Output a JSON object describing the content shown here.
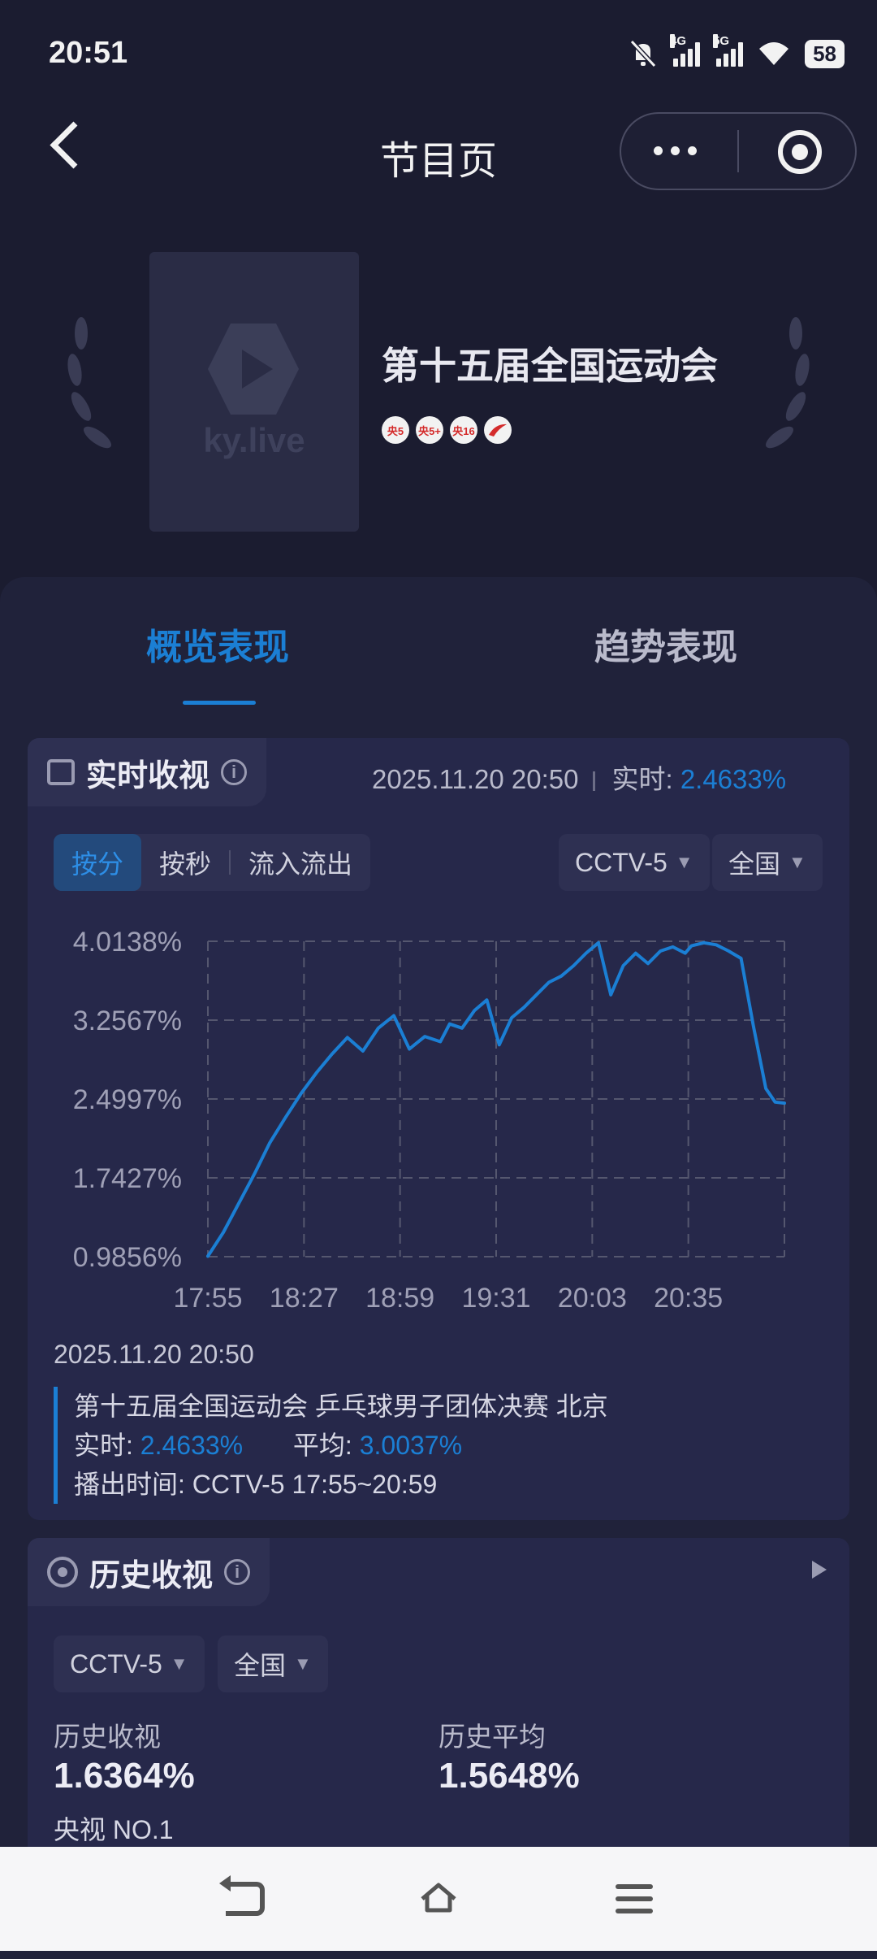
{
  "status_bar": {
    "time": "20:51",
    "net1": "4G",
    "net2": "5G",
    "battery": "58"
  },
  "nav": {
    "title": "节目页"
  },
  "program": {
    "poster_text": "ky.live",
    "title": "第十五届全国运动会",
    "channel_badges": [
      "央5",
      "央5+",
      "央16",
      ""
    ]
  },
  "tabs": [
    "概览表现",
    "趋势表现"
  ],
  "realtime": {
    "title": "实时收视",
    "info_icon": "i",
    "datetime": "2025.11.20 20:50",
    "realtime_label": "实时:",
    "realtime_value": "2.4633%",
    "segments": [
      "按分",
      "按秒",
      "流入流出"
    ],
    "channel_select": "CCTV-5",
    "region_select": "全国"
  },
  "chart_data": {
    "type": "line",
    "ylim": [
      0.9856,
      4.0138
    ],
    "y_ticks": [
      "4.0138%",
      "3.2567%",
      "2.4997%",
      "1.7427%",
      "0.9856%"
    ],
    "x_ticks": [
      "17:55",
      "18:27",
      "18:59",
      "19:31",
      "20:03",
      "20:35"
    ],
    "x_minutes_range": [
      0,
      186
    ],
    "grid": true,
    "series": [
      {
        "color": "#1b7fd4",
        "x": [
          0,
          5,
          10,
          15,
          20,
          25,
          30,
          35,
          40,
          45,
          50,
          55,
          60,
          65,
          70,
          75,
          78,
          82,
          86,
          90,
          94,
          98,
          102,
          106,
          110,
          114,
          118,
          122,
          126,
          130,
          134,
          138,
          142,
          146,
          150,
          154,
          156,
          160,
          164,
          168,
          172,
          176,
          180,
          183,
          186
        ],
        "y": [
          0.99,
          1.22,
          1.5,
          1.78,
          2.08,
          2.32,
          2.55,
          2.75,
          2.93,
          3.09,
          2.96,
          3.18,
          3.3,
          2.98,
          3.1,
          3.05,
          3.22,
          3.18,
          3.35,
          3.45,
          3.02,
          3.28,
          3.38,
          3.5,
          3.62,
          3.68,
          3.78,
          3.9,
          4.0,
          3.5,
          3.78,
          3.9,
          3.8,
          3.92,
          3.96,
          3.9,
          3.97,
          4.0,
          3.98,
          3.92,
          3.85,
          3.2,
          2.6,
          2.47,
          2.46
        ]
      }
    ]
  },
  "tooltip": {
    "time": "2025.11.20 20:50",
    "program": "第十五届全国运动会 乒乓球男子团体决赛 北京",
    "realtime_label": "实时:",
    "realtime_value": "2.4633%",
    "average_label": "平均:",
    "average_value": "3.0037%",
    "airtime_label": "播出时间:",
    "airtime_value": "CCTV-5 17:55~20:59"
  },
  "history": {
    "title": "历史收视",
    "info_icon": "i",
    "channel_select": "CCTV-5",
    "region_select": "全国",
    "rating_label": "历史收视",
    "rating_value": "1.6364%",
    "average_label": "历史平均",
    "average_value": "1.5648%",
    "rank": "央视 NO.1"
  }
}
